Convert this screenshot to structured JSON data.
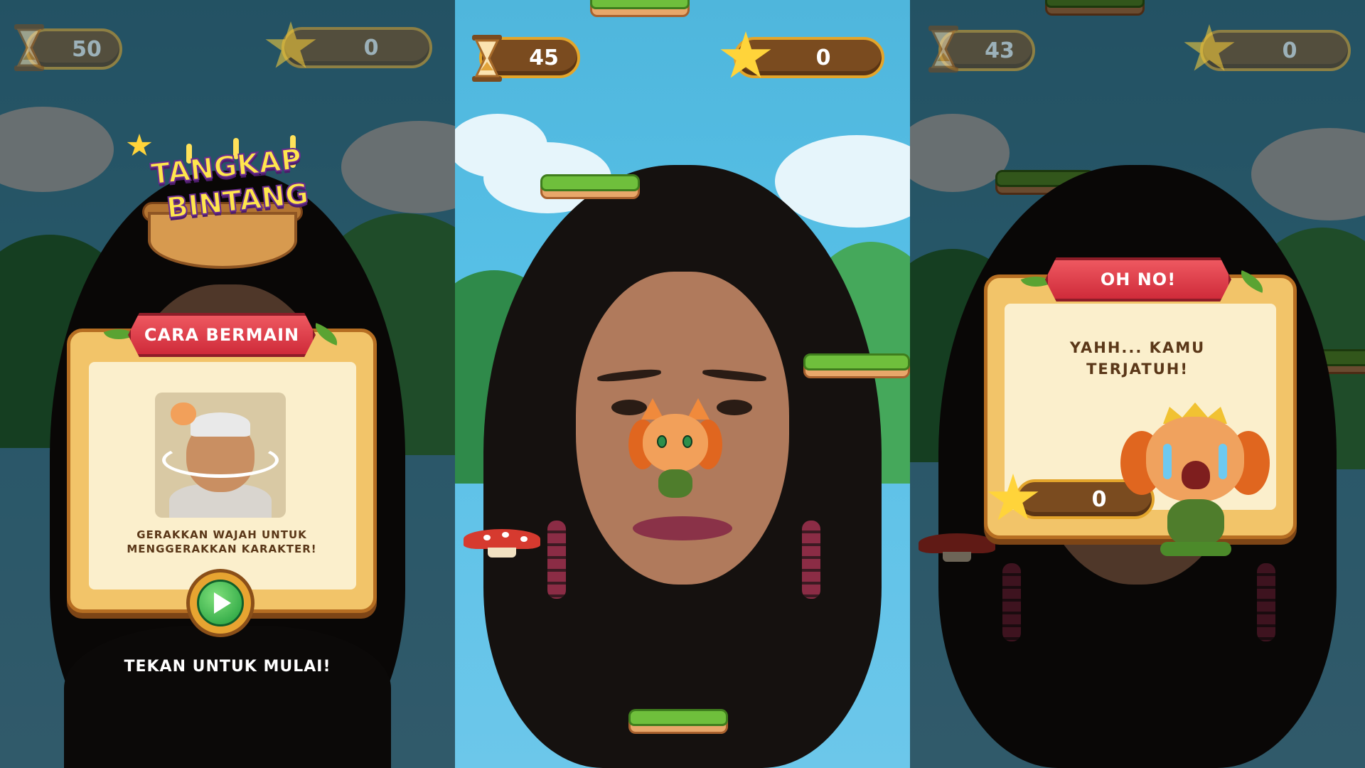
{
  "screens": {
    "left": {
      "timer": "50",
      "score": "0",
      "logo_line1": "TANGKAP",
      "logo_line2": "BINTANG",
      "card_title": "CARA BERMAIN",
      "instruction": "GERAKKAN WAJAH UNTUK MENGGERAKKAN KARAKTER!",
      "start_hint": "TEKAN UNTUK MULAI!"
    },
    "middle": {
      "timer": "45",
      "score": "0"
    },
    "right": {
      "timer": "43",
      "score": "0",
      "card_title": "OH NO!",
      "message_line1": "YAHH... KAMU",
      "message_line2": "TERJATUH!",
      "result_score": "0"
    }
  },
  "icons": {
    "timer": "hourglass-icon",
    "score": "star-icon",
    "play": "play-icon"
  },
  "colors": {
    "sky": "#56bfe6",
    "hud_fill": "#7a4b1f",
    "hud_border": "#e3a52b",
    "ribbon_red": "#d63a45",
    "card_paper": "#fbefcc",
    "play_green": "#1e9c3a"
  }
}
